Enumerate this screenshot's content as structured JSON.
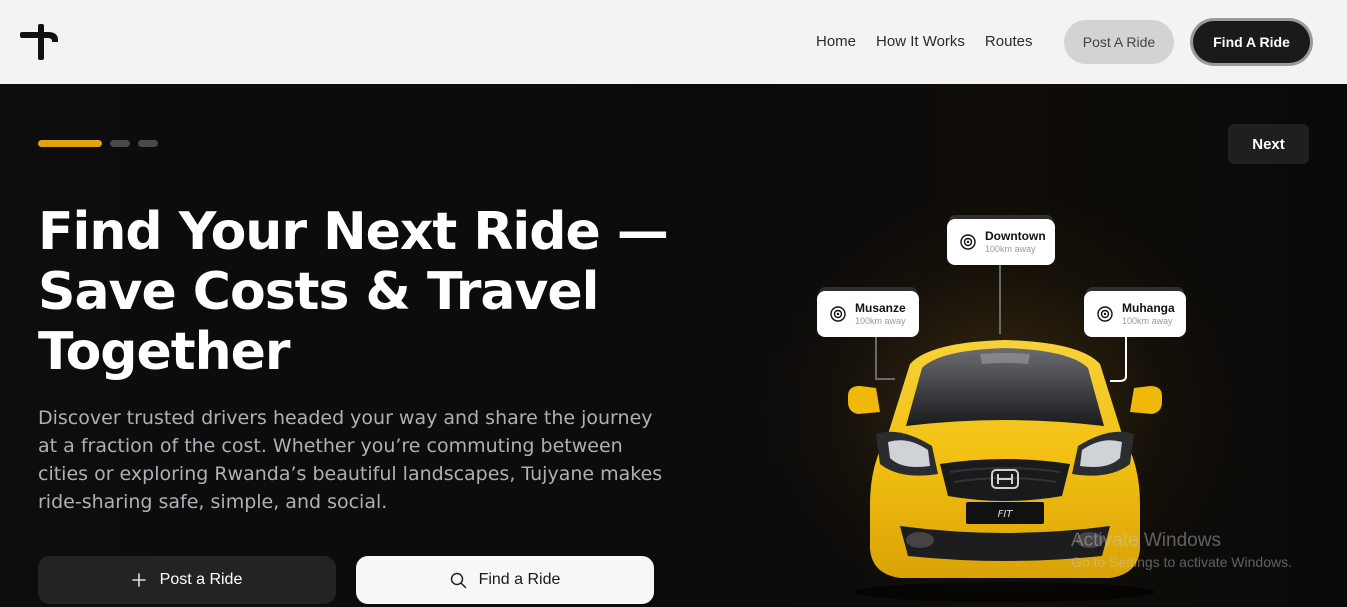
{
  "nav": {
    "links": [
      "Home",
      "How It Works",
      "Routes"
    ],
    "post_label": "Post A Ride",
    "find_label": "Find A Ride"
  },
  "hero": {
    "progress": {
      "active_index": 0,
      "total": 3
    },
    "next_label": "Next",
    "title_lines": [
      "Find Your Next Ride —",
      "Save Costs & Travel",
      "Together"
    ],
    "description": "Discover trusted drivers headed your way and share the journey at a fraction of the cost. Whether you’re commuting between cities or exploring Rwanda’s beautiful landscapes, Tujyane makes ride-sharing safe, simple, and social.",
    "post_label": "Post a Ride",
    "find_label": "Find a Ride"
  },
  "locations": [
    {
      "name": "Downtown",
      "distance": "100km away"
    },
    {
      "name": "Musanze",
      "distance": "100km away"
    },
    {
      "name": "Muhanga",
      "distance": "100km away"
    }
  ],
  "watermark": {
    "title": "Activate Windows",
    "subtitle": "Go to Settings to activate Windows."
  },
  "colors": {
    "accent": "#e2a20e",
    "hero_bg": "#0b0b0c",
    "nav_bg": "#f3f3f4",
    "car_yellow": "#f2c011"
  }
}
